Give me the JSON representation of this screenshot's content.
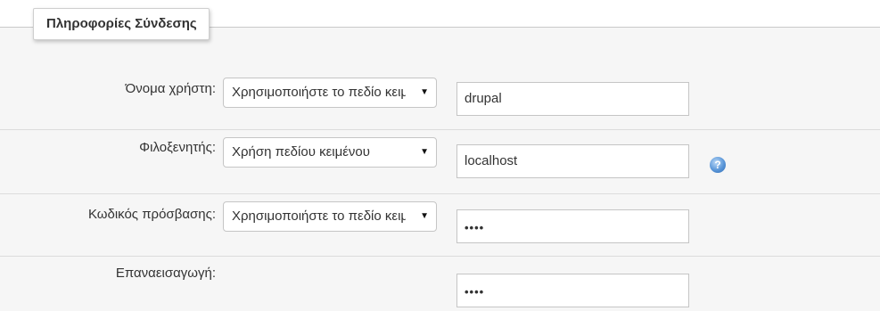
{
  "legend": "Πληροφορίες Σύνδεσης",
  "rows": [
    {
      "label": "Όνομα χρήστη:",
      "select_value": "Χρησιμοποιήστε το πεδίο κειμένου",
      "input_value": "drupal"
    },
    {
      "label": "Φιλοξενητής:",
      "select_value": "Χρήση πεδίου κειμένου",
      "input_value": "localhost",
      "help_icon": "help-icon"
    },
    {
      "label": "Κωδικός πρόσβασης:",
      "select_value": "Χρησιμοποιήστε το πεδίο κειμένου",
      "input_value": "••••"
    },
    {
      "label": "Επαναεισαγωγή:",
      "input_value": "••••"
    }
  ],
  "caret": "▼",
  "help_glyph": "?"
}
